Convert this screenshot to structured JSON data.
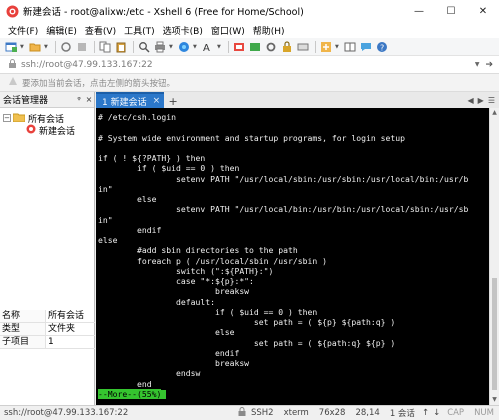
{
  "window": {
    "title": "新建会话 - root@alixw:/etc - Xshell 6 (Free for Home/School)",
    "minimize": "—",
    "maximize": "☐",
    "close": "✕"
  },
  "menu": [
    "文件(F)",
    "编辑(E)",
    "查看(V)",
    "工具(T)",
    "选项卡(B)",
    "窗口(W)",
    "帮助(H)"
  ],
  "address": {
    "value": "ssh://root@47.99.133.167:22"
  },
  "hint": {
    "text": "要添加当前会话，点击左侧的箭头按钮。"
  },
  "session_manager": {
    "title": "会话管理器",
    "pin": "ᵠ",
    "close": "×",
    "tree": {
      "root": "所有会话",
      "child": "新建会话"
    },
    "props": [
      {
        "k": "名称",
        "v": "所有会话"
      },
      {
        "k": "类型",
        "v": "文件夹"
      },
      {
        "k": "子项目",
        "v": "1"
      }
    ]
  },
  "tab": {
    "label": "1 新建会话",
    "close": "×",
    "add": "+"
  },
  "terminal": {
    "lines": [
      "# /etc/csh.login",
      "",
      "# System wide environment and startup programs, for login setup",
      "",
      "if ( ! ${?PATH} ) then",
      "        if ( $uid == 0 ) then",
      "                setenv PATH \"/usr/local/sbin:/usr/sbin:/usr/local/bin:/usr/b",
      "in\"",
      "        else",
      "                setenv PATH \"/usr/local/bin:/usr/bin:/usr/local/sbin:/usr/sb",
      "in\"",
      "        endif",
      "else",
      "        #add sbin directories to the path",
      "        foreach p ( /usr/local/sbin /usr/sbin )",
      "                switch (\":${PATH}:\")",
      "                case \"*:${p}:*\":",
      "                        breaksw",
      "                default:",
      "                        if ( $uid == 0 ) then",
      "                                set path = ( ${p} ${path:q} )",
      "                        else",
      "                                set path = ( ${path:q} ${p} )",
      "                        endif",
      "                        breaksw",
      "                endsw",
      "        end"
    ],
    "more": "--More--(55%)"
  },
  "status": {
    "connection": "ssh://root@47.99.133.167:22",
    "protocol": "SSH2",
    "term": "xterm",
    "size": "76x28",
    "cursor": "28,14",
    "sessions": "1 会话",
    "cap": "CAP",
    "num": "NUM"
  },
  "colors": {
    "tab_active": "#2b77c9",
    "terminal_bg": "#000000",
    "terminal_fg": "#f0f0f0",
    "more_bg": "#35c42f"
  }
}
